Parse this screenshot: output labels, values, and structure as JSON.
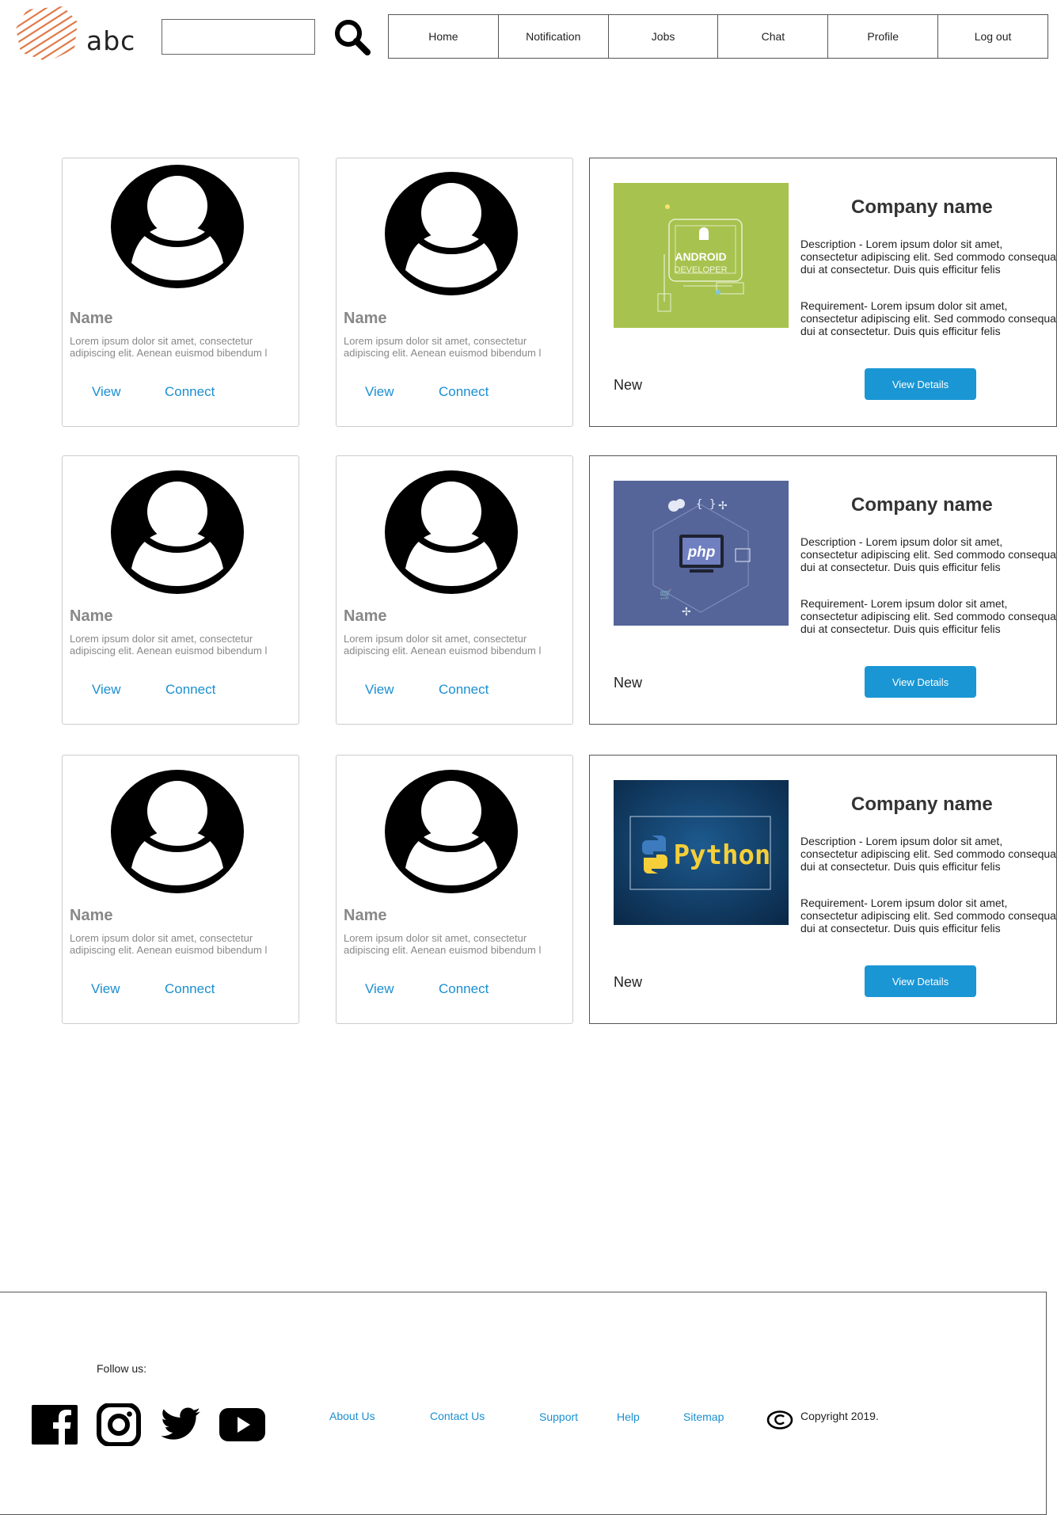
{
  "header": {
    "logo_text": "abc",
    "search": {
      "placeholder": "",
      "value": ""
    },
    "nav": [
      "Home",
      "Notification",
      "Jobs",
      "Chat",
      "Profile",
      "Log out"
    ]
  },
  "people": [
    {
      "name": "Name",
      "desc": "Lorem ipsum dolor sit amet, consectetur adipiscing elit. Aenean euismod bibendum l",
      "view": "View",
      "connect": "Connect"
    },
    {
      "name": "Name",
      "desc": "Lorem ipsum dolor sit amet, consectetur adipiscing elit. Aenean euismod bibendum l",
      "view": "View",
      "connect": "Connect"
    },
    {
      "name": "Name",
      "desc": "Lorem ipsum dolor sit amet, consectetur adipiscing elit. Aenean euismod bibendum l",
      "view": "View",
      "connect": "Connect"
    },
    {
      "name": "Name",
      "desc": "Lorem ipsum dolor sit amet, consectetur adipiscing elit. Aenean euismod bibendum l",
      "view": "View",
      "connect": "Connect"
    },
    {
      "name": "Name",
      "desc": "Lorem ipsum dolor sit amet, consectetur adipiscing elit. Aenean euismod bibendum l",
      "view": "View",
      "connect": "Connect"
    },
    {
      "name": "Name",
      "desc": "Lorem ipsum dolor sit amet, consectetur adipiscing elit. Aenean euismod bibendum l",
      "view": "View",
      "connect": "Connect"
    }
  ],
  "jobs": [
    {
      "image_label_1": "ANDROID",
      "image_label_2": "DEVELOPER",
      "company": "Company name",
      "description": "Description - Lorem ipsum dolor sit amet, consectetur adipiscing elit. Sed commodo consequat dui at consectetur. Duis quis efficitur felis",
      "requirement": "Requirement- Lorem ipsum dolor sit amet, consectetur adipiscing elit. Sed commodo consequat dui at consectetur. Duis quis efficitur felis",
      "status": "New",
      "button": "View Details",
      "image_color": "#a8c24f"
    },
    {
      "image_label_1": "php",
      "company": "Company name",
      "description": "Description - Lorem ipsum dolor sit amet, consectetur adipiscing elit. Sed commodo consequat dui at consectetur. Duis quis efficitur felis",
      "requirement": "Requirement- Lorem ipsum dolor sit amet, consectetur adipiscing elit. Sed commodo consequat dui at consectetur. Duis quis efficitur felis",
      "status": "New",
      "button": "View Details",
      "image_color": "#55659a"
    },
    {
      "image_label_1": "Python",
      "company": "Company name",
      "description": "Description - Lorem ipsum dolor sit amet, consectetur adipiscing elit. Sed commodo consequat dui at consectetur. Duis quis efficitur felis",
      "requirement": "Requirement- Lorem ipsum dolor sit amet, consectetur adipiscing elit. Sed commodo consequat dui at consectetur. Duis quis efficitur felis",
      "status": "New",
      "button": "View Details",
      "image_color": "#123a62"
    }
  ],
  "footer": {
    "follow_label": "Follow us:",
    "social_icons": [
      "facebook-icon",
      "instagram-icon",
      "twitter-icon",
      "youtube-icon"
    ],
    "links": [
      "About Us",
      "Contact Us",
      "Support",
      "Help",
      "Sitemap"
    ],
    "copyright": "Copyright 2019."
  },
  "colors": {
    "link": "#1a8fd1",
    "button": "#1a96d4",
    "logo": "#e07a4a"
  }
}
